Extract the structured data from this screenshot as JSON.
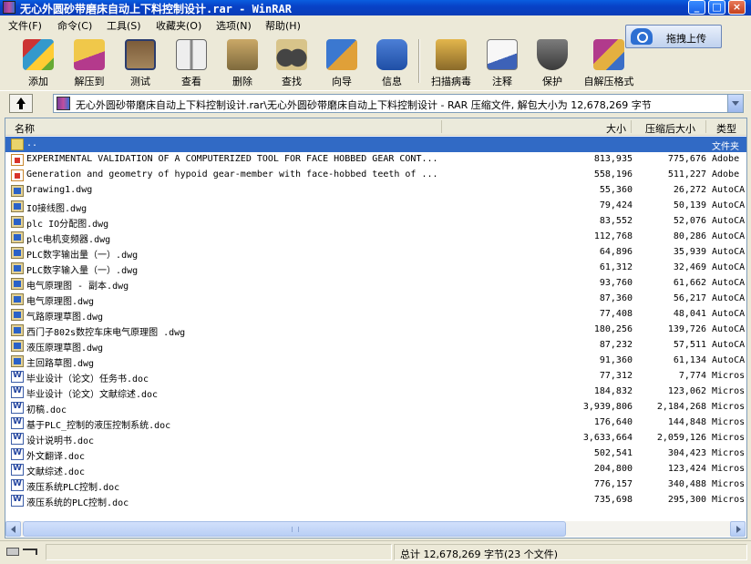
{
  "window": {
    "title": "无心外圆砂带磨床自动上下料控制设计.rar - WinRAR",
    "buttons": {
      "minimize": "_",
      "maximize": "□",
      "close": "×"
    }
  },
  "menu": [
    "文件(F)",
    "命令(C)",
    "工具(S)",
    "收藏夹(O)",
    "选项(N)",
    "帮助(H)"
  ],
  "upload_button": "拖拽上传",
  "toolbar": [
    {
      "label": "添加",
      "icon": "add-books-icon"
    },
    {
      "label": "解压到",
      "icon": "extract-folder-icon"
    },
    {
      "label": "测试",
      "icon": "test-clipboard-icon"
    },
    {
      "label": "查看",
      "icon": "view-book-icon"
    },
    {
      "label": "删除",
      "icon": "delete-trash-icon"
    },
    {
      "label": "查找",
      "icon": "find-binoculars-icon"
    },
    {
      "label": "向导",
      "icon": "wizard-icon"
    },
    {
      "label": "信息",
      "icon": "info-icon"
    },
    {
      "label": "扫描病毒",
      "icon": "virus-scan-icon"
    },
    {
      "label": "注释",
      "icon": "comment-icon"
    },
    {
      "label": "保护",
      "icon": "protect-shield-icon"
    },
    {
      "label": "自解压格式",
      "icon": "sfx-icon"
    }
  ],
  "address": "无心外圆砂带磨床自动上下料控制设计.rar\\无心外圆砂带磨床自动上下料控制设计 - RAR 压缩文件, 解包大小为 12,678,269 字节",
  "columns": {
    "name": "名称",
    "size": "大小",
    "packed": "压缩后大小",
    "type": "类型"
  },
  "files": [
    {
      "name": "..",
      "size": "",
      "packed": "",
      "type": "文件夹",
      "icon": "folder"
    },
    {
      "name": "EXPERIMENTAL VALIDATION OF A COMPUTERIZED TOOL FOR FACE HOBBED GEAR CONT...",
      "size": "813,935",
      "packed": "775,676",
      "type": "Adobe",
      "icon": "pdf"
    },
    {
      "name": "Generation and geometry of hypoid gear-member with face-hobbed teeth of ...",
      "size": "558,196",
      "packed": "511,227",
      "type": "Adobe",
      "icon": "pdf"
    },
    {
      "name": "Drawing1.dwg",
      "size": "55,360",
      "packed": "26,272",
      "type": "AutoCA",
      "icon": "dwg"
    },
    {
      "name": "IO接线图.dwg",
      "size": "79,424",
      "packed": "50,139",
      "type": "AutoCA",
      "icon": "dwg"
    },
    {
      "name": "plc IO分配图.dwg",
      "size": "83,552",
      "packed": "52,076",
      "type": "AutoCA",
      "icon": "dwg"
    },
    {
      "name": "plc电机变频器.dwg",
      "size": "112,768",
      "packed": "80,286",
      "type": "AutoCA",
      "icon": "dwg"
    },
    {
      "name": "PLC数字输出量（一）.dwg",
      "size": "64,896",
      "packed": "35,939",
      "type": "AutoCA",
      "icon": "dwg"
    },
    {
      "name": "PLC数字输入量（一）.dwg",
      "size": "61,312",
      "packed": "32,469",
      "type": "AutoCA",
      "icon": "dwg"
    },
    {
      "name": "电气原理图 - 副本.dwg",
      "size": "93,760",
      "packed": "61,662",
      "type": "AutoCA",
      "icon": "dwg"
    },
    {
      "name": "电气原理图.dwg",
      "size": "87,360",
      "packed": "56,217",
      "type": "AutoCA",
      "icon": "dwg"
    },
    {
      "name": "气路原理草图.dwg",
      "size": "77,408",
      "packed": "48,041",
      "type": "AutoCA",
      "icon": "dwg"
    },
    {
      "name": "西门子802s数控车床电气原理图 .dwg",
      "size": "180,256",
      "packed": "139,726",
      "type": "AutoCA",
      "icon": "dwg"
    },
    {
      "name": "液压原理草图.dwg",
      "size": "87,232",
      "packed": "57,511",
      "type": "AutoCA",
      "icon": "dwg"
    },
    {
      "name": "主回路草图.dwg",
      "size": "91,360",
      "packed": "61,134",
      "type": "AutoCA",
      "icon": "dwg"
    },
    {
      "name": "毕业设计（论文）任务书.doc",
      "size": "77,312",
      "packed": "7,774",
      "type": "Micros",
      "icon": "doc"
    },
    {
      "name": "毕业设计（论文）文献综述.doc",
      "size": "184,832",
      "packed": "123,062",
      "type": "Micros",
      "icon": "doc"
    },
    {
      "name": "初稿.doc",
      "size": "3,939,806",
      "packed": "2,184,268",
      "type": "Micros",
      "icon": "doc"
    },
    {
      "name": "基于PLC_控制的液压控制系统.doc",
      "size": "176,640",
      "packed": "144,848",
      "type": "Micros",
      "icon": "doc"
    },
    {
      "name": "设计说明书.doc",
      "size": "3,633,664",
      "packed": "2,059,126",
      "type": "Micros",
      "icon": "doc"
    },
    {
      "name": "外文翻译.doc",
      "size": "502,541",
      "packed": "304,423",
      "type": "Micros",
      "icon": "doc"
    },
    {
      "name": "文献综述.doc",
      "size": "204,800",
      "packed": "123,424",
      "type": "Micros",
      "icon": "doc"
    },
    {
      "name": "液压系统PLC控制.doc",
      "size": "776,157",
      "packed": "340,488",
      "type": "Micros",
      "icon": "doc"
    },
    {
      "name": "液压系统的PLC控制.doc",
      "size": "735,698",
      "packed": "295,300",
      "type": "Micros",
      "icon": "doc"
    }
  ],
  "status": "总计 12,678,269 字节(23 个文件)"
}
